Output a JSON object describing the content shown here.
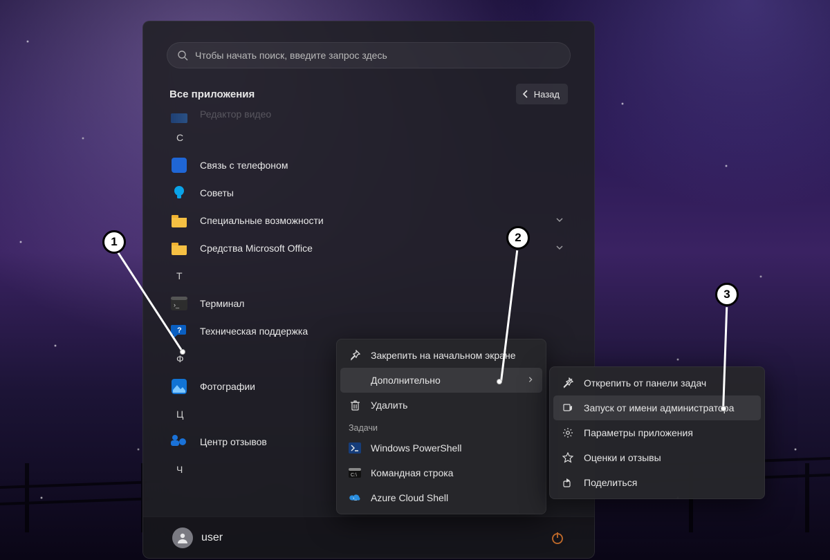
{
  "search": {
    "placeholder": "Чтобы начать поиск, введите запрос здесь"
  },
  "header": {
    "title": "Все приложения",
    "back": "Назад"
  },
  "apps": {
    "partial_top": "Редактор видео",
    "letter_c": "С",
    "phone_link": "Связь с телефоном",
    "tips": "Советы",
    "accessibility": "Специальные возможности",
    "office_tools": "Средства Microsoft Office",
    "letter_t": "Т",
    "terminal": "Терминал",
    "get_help": "Техническая поддержка",
    "letter_f": "Ф",
    "photos": "Фотографии",
    "letter_ts": "Ц",
    "feedback_hub": "Центр отзывов",
    "letter_ch": "Ч"
  },
  "footer": {
    "user": "user"
  },
  "ctx1": {
    "pin_start": "Закрепить на начальном экране",
    "more": "Дополнительно",
    "uninstall": "Удалить",
    "tasks_label": "Задачи",
    "powershell": "Windows PowerShell",
    "cmd": "Командная строка",
    "azure": "Azure Cloud Shell"
  },
  "ctx2": {
    "unpin_taskbar": "Открепить от панели задач",
    "run_as_admin": "Запуск от имени администратора",
    "app_settings": "Параметры приложения",
    "rate_review": "Оценки и отзывы",
    "share": "Поделиться"
  },
  "callouts": {
    "one": "1",
    "two": "2",
    "three": "3"
  }
}
